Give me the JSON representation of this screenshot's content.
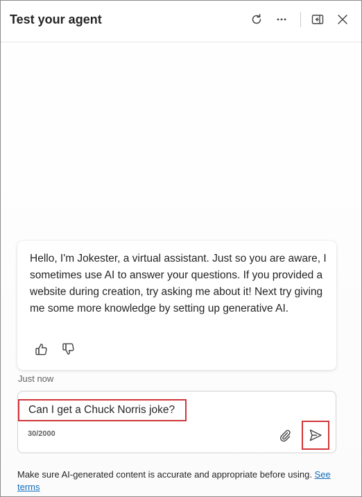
{
  "header": {
    "title": "Test your agent",
    "icons": [
      "refresh-icon",
      "more-icon",
      "collapse-panel-icon",
      "close-icon"
    ]
  },
  "message": {
    "text": "Hello, I'm Jokester, a virtual assistant. Just so you are aware, I sometimes use AI to answer your questions. If you provided a website during creation, try asking me about it! Next try giving me some more knowledge by setting up generative AI.",
    "timestamp": "Just now"
  },
  "input": {
    "value": "Can I get a Chuck Norris joke?",
    "counter": "30/2000"
  },
  "footer": {
    "disclaimer": "Make sure AI-generated content is accurate and appropriate before using.",
    "link_label": "See terms"
  },
  "colors": {
    "highlight": "#d13438",
    "link": "#0f6cbd",
    "text": "#242424"
  }
}
